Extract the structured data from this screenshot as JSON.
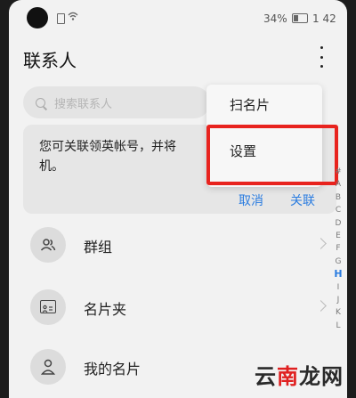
{
  "status_bar": {
    "battery": "34%",
    "time": "1 42"
  },
  "header": {
    "title": "联系人"
  },
  "search": {
    "placeholder": "搜索联系人"
  },
  "link_card": {
    "message": "您可关联领英帐号，并将",
    "message_line2": "机。",
    "cancel_label": "取消",
    "link_label": "关联"
  },
  "menu": {
    "items": [
      "扫名片",
      "设置"
    ]
  },
  "alpha_index": [
    "#",
    "A",
    "B",
    "C",
    "D",
    "E",
    "F",
    "G",
    "H",
    "I",
    "J",
    "K",
    "L"
  ],
  "alpha_active": "H",
  "list": [
    {
      "label": "群组",
      "icon": "group-icon"
    },
    {
      "label": "名片夹",
      "icon": "card-holder-icon"
    },
    {
      "label": "我的名片",
      "icon": "person-icon"
    }
  ],
  "watermark": {
    "prefix": "云",
    "accent": "南",
    "suffix": "龙网"
  },
  "colors": {
    "accent": "#2a7ce0",
    "highlight": "#e8231e"
  }
}
